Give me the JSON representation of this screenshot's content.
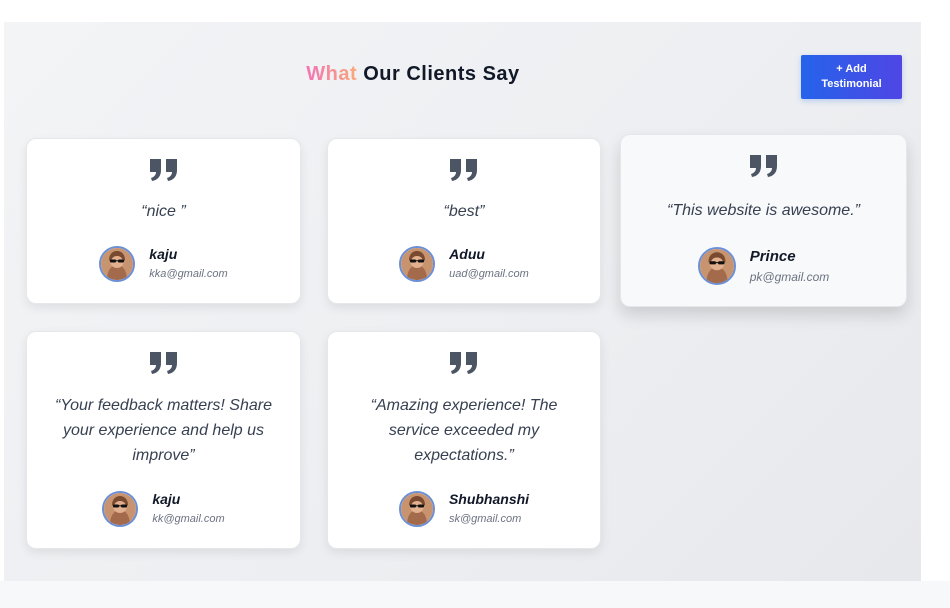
{
  "header": {
    "title_accent": "What",
    "title_rest": " Our Clients Say",
    "add_button_line1": "+ Add",
    "add_button_line2": "Testimonial"
  },
  "colors": {
    "accent_gradient_start": "#f472b6",
    "accent_gradient_end": "#f9a979",
    "button_gradient_start": "#2563eb",
    "button_gradient_end": "#4f46e5"
  },
  "icons": {
    "quote": "quote-icon",
    "avatar": "avatar"
  },
  "testimonials": [
    {
      "quote": "“nice ”",
      "name": "kaju",
      "email": "kka@gmail.com"
    },
    {
      "quote": "“best”",
      "name": "Aduu",
      "email": "uad@gmail.com"
    },
    {
      "quote": "“This website is awesome.”",
      "name": "Prince",
      "email": "pk@gmail.com"
    },
    {
      "quote": "“Your feedback matters! Share your experience and help us improve”",
      "name": "kaju",
      "email": "kk@gmail.com"
    },
    {
      "quote": "“Amazing experience! The service exceeded my expectations.”",
      "name": "Shubhanshi",
      "email": "sk@gmail.com"
    }
  ]
}
